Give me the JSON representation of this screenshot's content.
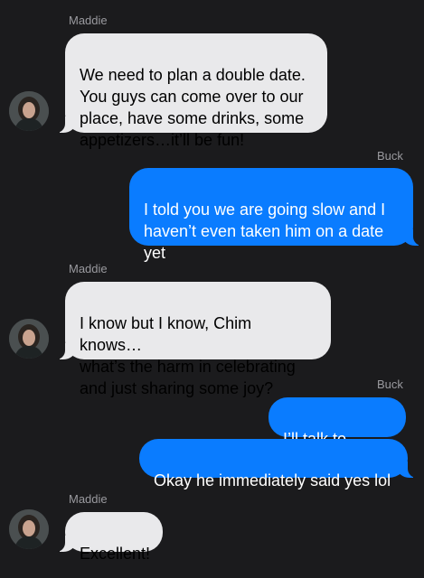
{
  "colors": {
    "background": "#1b1b1d",
    "incoming_bubble": "#e9e9eb",
    "outgoing_bubble": "#0a7cff",
    "sender_label": "#9a9a9f"
  },
  "messages": [
    {
      "from": "Maddie",
      "direction": "incoming",
      "show_sender": true,
      "text": "We need to plan a double date.\nYou guys can come over to our\nplace, have some drinks, some\nappetizers…it’ll be fun!"
    },
    {
      "from": "Buck",
      "direction": "outgoing",
      "show_sender": true,
      "text": "I told you we are going slow and I\nhaven’t even taken him on a date\nyet"
    },
    {
      "from": "Maddie",
      "direction": "incoming",
      "show_sender": true,
      "text": "I know but I know, Chim knows…\nwhat’s the harm in celebrating\nand just sharing some joy?"
    },
    {
      "from": "Buck",
      "direction": "outgoing",
      "show_sender": true,
      "text": "I’ll talk to Eddie"
    },
    {
      "from": "Buck",
      "direction": "outgoing",
      "show_sender": false,
      "text": "Okay he immediately said yes lol"
    },
    {
      "from": "Maddie",
      "direction": "incoming",
      "show_sender": true,
      "text": "Excellent!"
    }
  ],
  "icons": {
    "avatar": "contact-photo-icon"
  }
}
